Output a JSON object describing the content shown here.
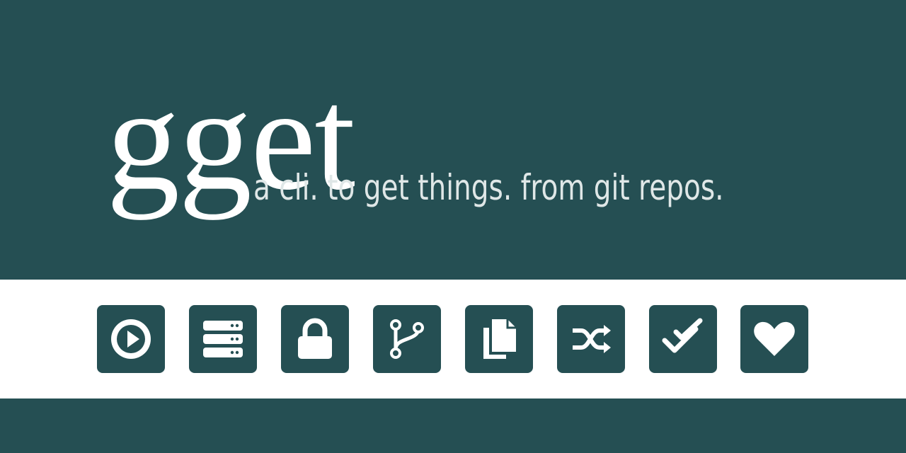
{
  "hero": {
    "title": "gget",
    "tagline": "a cli. to get things. from git repos."
  },
  "colors": {
    "background": "#254f53",
    "band": "#ffffff",
    "tile": "#254f53",
    "icon": "#ffffff",
    "tagline": "#dfe7e7"
  },
  "icons": [
    "play-circle-icon",
    "server-stack-icon",
    "lock-icon",
    "code-branch-icon",
    "copy-files-icon",
    "shuffle-icon",
    "double-check-icon",
    "heart-icon"
  ]
}
